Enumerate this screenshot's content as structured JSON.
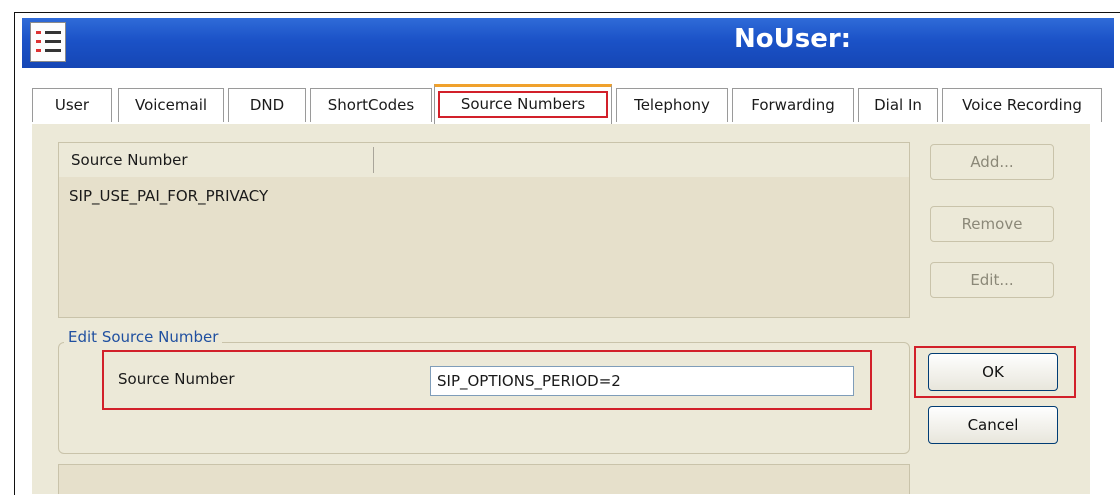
{
  "window": {
    "title": "NoUser:",
    "icon": "list-icon"
  },
  "tabs": [
    {
      "label": "User"
    },
    {
      "label": "Voicemail"
    },
    {
      "label": "DND"
    },
    {
      "label": "ShortCodes"
    },
    {
      "label": "Source Numbers",
      "active": true
    },
    {
      "label": "Telephony"
    },
    {
      "label": "Forwarding"
    },
    {
      "label": "Dial In"
    },
    {
      "label": "Voice Recording"
    }
  ],
  "list": {
    "column_header": "Source Number",
    "items": [
      "SIP_USE_PAI_FOR_PRIVACY"
    ]
  },
  "side_buttons": {
    "add": "Add...",
    "remove": "Remove",
    "edit": "Edit..."
  },
  "edit_group": {
    "title": "Edit Source Number",
    "field_label": "Source Number",
    "field_value": "SIP_OPTIONS_PERIOD=2"
  },
  "actions": {
    "ok": "OK",
    "cancel": "Cancel"
  },
  "colors": {
    "titlebar": "#1b52c7",
    "highlight": "#d2202a",
    "panel": "#ece9d8",
    "active_tab_accent": "#f0a12c"
  }
}
